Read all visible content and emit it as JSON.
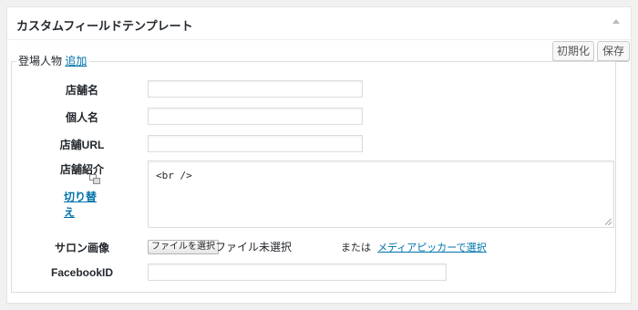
{
  "box": {
    "title": "カスタムフィールドテンプレート"
  },
  "buttons": {
    "initialize": "初期化",
    "save": "保存"
  },
  "group": {
    "name": "登場人物",
    "add_link": "追加"
  },
  "fields": {
    "shop_name": {
      "label": "店舗名",
      "value": ""
    },
    "person_name": {
      "label": "個人名",
      "value": ""
    },
    "shop_url": {
      "label": "店舗URL",
      "value": ""
    },
    "shop_intro": {
      "label": "店舗紹介",
      "value": "<br />",
      "switch_label": "切り替え"
    },
    "salon_image": {
      "label": "サロン画像",
      "file_button": "ファイルを選択",
      "file_status": "ファイル未選択",
      "or_text": "または",
      "media_link": "メディアピッカーで選択"
    },
    "facebook_id": {
      "label": "FacebookID",
      "value": ""
    }
  }
}
